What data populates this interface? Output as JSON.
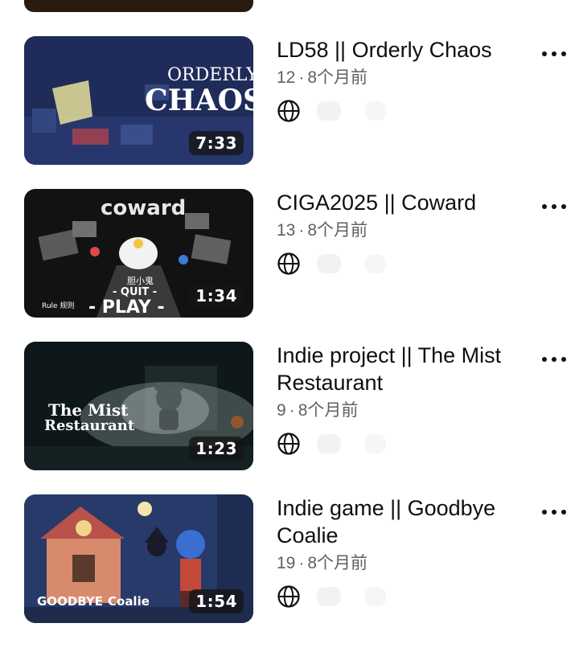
{
  "videos": [
    {
      "title": "LD58 || Orderly Chaos",
      "views": "12",
      "age": "8个月前",
      "duration": "7:33",
      "thumb_text": [
        "ORDERLY",
        "CHAOS"
      ],
      "thumb_bg": "#1e2a55"
    },
    {
      "title": "CIGA2025 || Coward",
      "views": "13",
      "age": "8个月前",
      "duration": "1:34",
      "thumb_text": [
        "coward",
        "胆小鬼",
        "- QUIT -",
        "- PLAY -",
        "Rule 规则"
      ],
      "thumb_bg": "#141414"
    },
    {
      "title": "Indie project || The Mist Restaurant",
      "views": "9",
      "age": "8个月前",
      "duration": "1:23",
      "thumb_text": [
        "The Mist",
        "Restaurant"
      ],
      "thumb_bg": "#0f1a1c"
    },
    {
      "title": "Indie game || Goodbye Coalie",
      "views": "19",
      "age": "8个月前",
      "duration": "1:54",
      "thumb_text": [
        "GOODBYE",
        "Coalie"
      ],
      "thumb_bg": "#2a3c6e"
    }
  ],
  "separator": "·",
  "icons": {
    "visibility": "globe-icon",
    "more": "more-vertical-icon"
  }
}
